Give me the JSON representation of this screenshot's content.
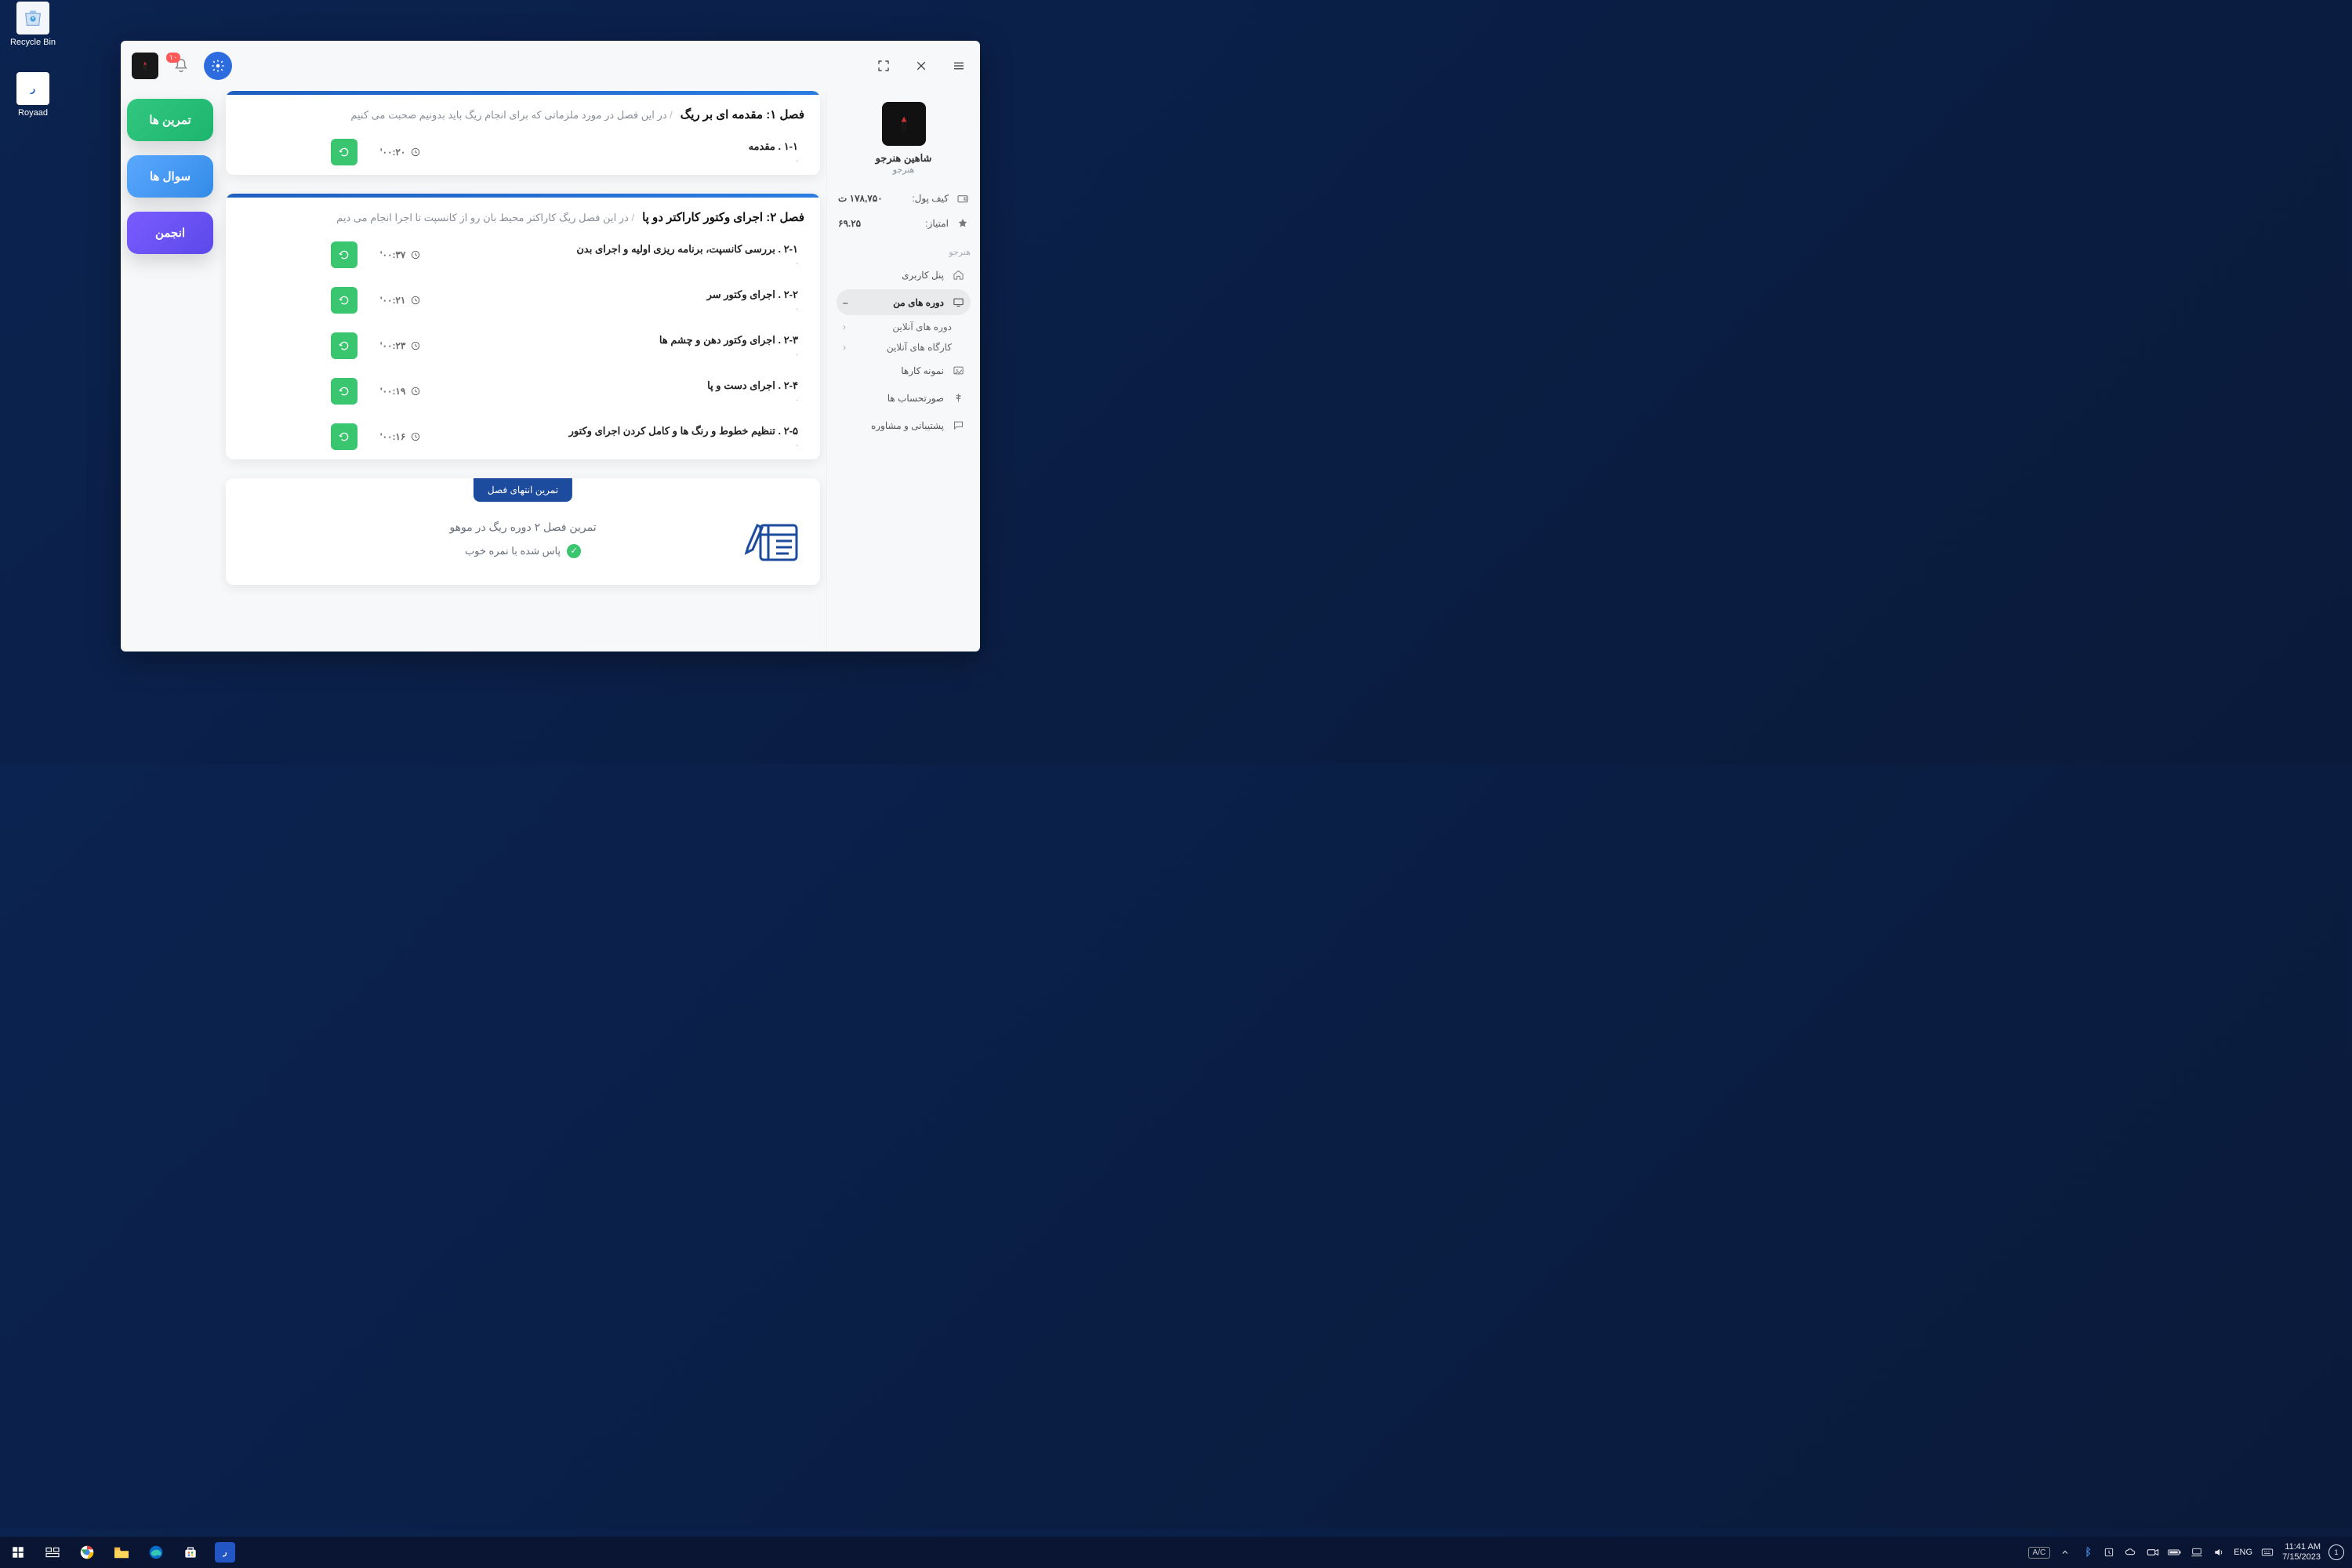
{
  "desktop": {
    "recycle": "Recycle Bin",
    "royaad": "Royaad"
  },
  "titlebar": {
    "notif_count": "۱۰"
  },
  "profile": {
    "name": "شاهین هنرجو",
    "role": "هنرجو",
    "wallet_label": "کیف پول:",
    "wallet_value": "۱۷۸,۷۵۰ ت",
    "score_label": "امتیاز:",
    "score_value": "۶۹.۲۵",
    "role_chip": "هنرجو",
    "nav": {
      "panel": "پنل کاربری",
      "courses": "دوره های من",
      "online_courses": "دوره های آنلاین",
      "online_workshops": "کارگاه های آنلاین",
      "portfolio": "نمونه کارها",
      "invoices": "صورتحساب ها",
      "support": "پشتیبانی و مشاوره"
    }
  },
  "tabs": {
    "exercises": "تمرین ها",
    "questions": "سوال ها",
    "forum": "انجمن"
  },
  "chapters": [
    {
      "title": "فصل ۱: مقدمه ای بر ریگ",
      "desc": "در این فصل در مورد ملزماتی که برای انجام ریگ باید بدونیم صحبت می کنیم",
      "lessons": [
        {
          "title": "۱-۱ . مقدمه",
          "sub": ".",
          "time": "۰۰:۲۰'"
        }
      ]
    },
    {
      "title": "فصل ۲: اجرای وکتور کاراکتر دو پا",
      "desc": "در این فصل ریگ کاراکتر محیط بان رو از کانسپت تا اجرا انجام می دیم",
      "lessons": [
        {
          "title": "۲-۱ . بررسی کانسپت، برنامه ریزی اولیه و اجرای بدن",
          "sub": ".",
          "time": "۰۰:۳۷'"
        },
        {
          "title": "۲-۲ . اجرای وکتور سر",
          "sub": ".",
          "time": "۰۰:۲۱'"
        },
        {
          "title": "۲-۳ . اجرای وکتور دهن و چشم ها",
          "sub": ".",
          "time": "۰۰:۲۳'"
        },
        {
          "title": "۲-۴ . اجرای دست و پا",
          "sub": ".",
          "time": "۰۰:۱۹'"
        },
        {
          "title": "۲-۵ . تنظیم خطوط و رنگ ها و کامل کردن اجرای وکتور",
          "sub": ".",
          "time": "۰۰:۱۶'"
        }
      ]
    }
  ],
  "exercise": {
    "badge": "تمرین انتهای فصل",
    "title": "تمرین فصل ۲ دوره ریگ در موهو",
    "status": "پاس شده با نمره خوب"
  },
  "taskbar": {
    "ac": "A/C",
    "lang": "ENG",
    "time": "11:41 AM",
    "date": "7/15/2023",
    "notif": "1"
  }
}
